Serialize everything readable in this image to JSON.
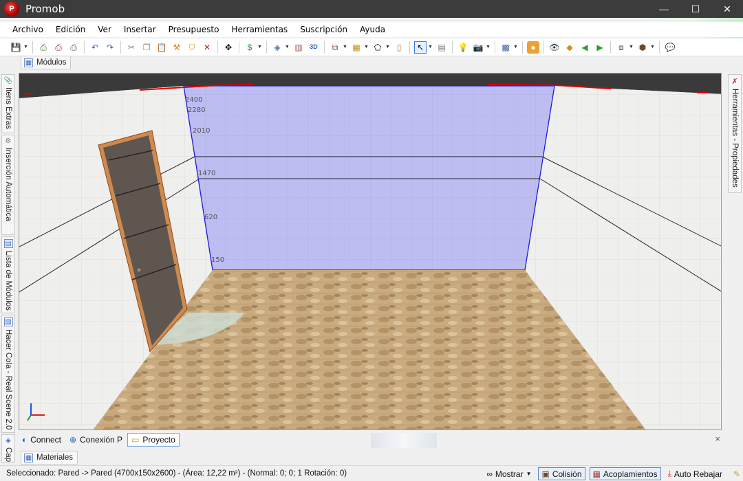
{
  "window": {
    "title": "Promob",
    "logo_text": "P",
    "minimize": "—",
    "maximize": "☐",
    "close": "✕"
  },
  "menu": [
    "Archivo",
    "Edición",
    "Ver",
    "Insertar",
    "Presupuesto",
    "Herramientas",
    "Suscripción",
    "Ayuda"
  ],
  "toolbar": {
    "icons": [
      "save-icon",
      "print-preview-icon",
      "print-icon",
      "printer-icon",
      "undo-icon",
      "redo-icon",
      "cut-icon",
      "copy-icon",
      "paste-icon",
      "hammer-icon",
      "paint-icon",
      "delete-icon",
      "move-icon",
      "price-icon",
      "layers-icon",
      "dimension-icon",
      "view-3d-icon",
      "wall-icon",
      "rack-icon",
      "shape-icon",
      "door-icon",
      "select-icon",
      "grid-icon",
      "light-icon",
      "camera-icon",
      "render-icon",
      "user-icon",
      "eye-icon",
      "shield-icon",
      "arrow-left-icon",
      "arrow-right-icon",
      "view-frame-icon",
      "box-icon",
      "chat-icon"
    ]
  },
  "tabs_top": {
    "modulos": "Módulos"
  },
  "left_tabs": [
    "Itens Extras",
    "Inserción Automática",
    "Lista de Módulos",
    "Hacer Cola - Real Scene 2.0",
    "Cap"
  ],
  "right_tab": "Herramientas - Propiedades",
  "scene": {
    "wall_labels": [
      "2400",
      "2280",
      "2010",
      "1470",
      "620",
      "150"
    ],
    "colors": {
      "selected_wall": "#b9b9f0",
      "wall_outline": "#1a1ae0",
      "ceiling": "#3a3a3a",
      "floor": "#c8a777",
      "door": "#5f5650",
      "door_frame": "#d08a4d"
    }
  },
  "bottom_tabs": [
    "Connect",
    "Conexión P",
    "Proyecto"
  ],
  "bottom_close": "×",
  "tabs_bottom": {
    "materiales": "Materiales"
  },
  "status": {
    "text": "Seleccionado: Pared -> Pared (4700x150x2600) - (Área: 12,22 m²) - (Normal: 0; 0; 1 Rotación: 0)",
    "mostrar": "Mostrar",
    "colision": "Colisión",
    "acoplamientos": "Acoplamientos",
    "auto_rebajar": "Auto Rebajar"
  }
}
